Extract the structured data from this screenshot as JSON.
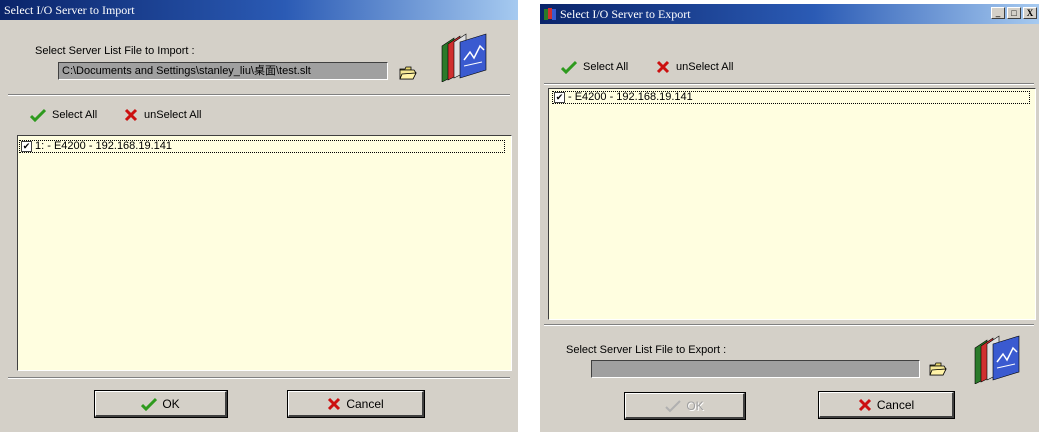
{
  "import_window": {
    "title": "Select I/O Server to Import",
    "file_label": "Select Server List File to Import :",
    "file_path": "C:\\Documents and Settings\\stanley_liu\\桌面\\test.slt",
    "toolbar": {
      "select_all": "Select All",
      "unselect_all": "unSelect All"
    },
    "items": [
      {
        "checked": true,
        "label": "1: - E4200 - 192.168.19.141"
      }
    ],
    "buttons": {
      "ok": "OK",
      "cancel": "Cancel"
    }
  },
  "export_window": {
    "title": "Select I/O Server to Export",
    "toolbar": {
      "select_all": "Select All",
      "unselect_all": "unSelect All"
    },
    "items": [
      {
        "checked": true,
        "label": "- E4200 - 192.168.19.141"
      }
    ],
    "file_label": "Select Server List File to Export :",
    "file_path": "",
    "buttons": {
      "ok": "OK",
      "cancel": "Cancel"
    },
    "window_controls": {
      "minimize": "_",
      "maximize": "□",
      "close": "X"
    }
  },
  "colors": {
    "title_active": "#0a246a",
    "list_bg": "#fffee0",
    "face": "#d4d0c8",
    "check_green": "#2e9a1e",
    "x_red": "#cc1010"
  }
}
